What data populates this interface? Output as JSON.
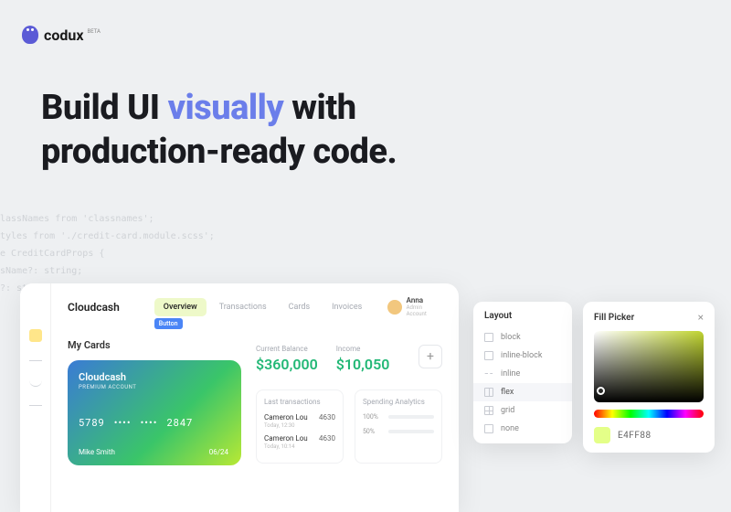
{
  "logo": {
    "text": "codux",
    "beta": "BETA"
  },
  "hero": {
    "pre": "Build UI ",
    "hl": "visually",
    "post": " with\nproduction-ready code."
  },
  "code_bg": "lassNames from 'classnames';\ntyles from './credit-card.module.scss';\ne CreditCardProps {\nsName?: string;\n?: string;",
  "dashboard": {
    "brand": "Cloudcash",
    "tabs": [
      {
        "label": "Overview",
        "active": true,
        "badge": "Button"
      },
      {
        "label": "Transactions",
        "active": false
      },
      {
        "label": "Cards",
        "active": false
      },
      {
        "label": "Invoices",
        "active": false
      }
    ],
    "user": {
      "name": "Anna",
      "subtitle": "Admin Account"
    },
    "mycards_label": "My Cards",
    "card": {
      "title": "Cloudcash",
      "subtitle": "PREMIUM ACCOUNT",
      "number_groups": [
        "5789",
        "••••",
        "••••",
        "2847"
      ],
      "holder": "Mike Smith",
      "expiry": "06/24"
    },
    "balance": {
      "label": "Current Balance",
      "value": "$360,000"
    },
    "income": {
      "label": "Income",
      "value": "$10,050"
    },
    "transactions_panel": {
      "title": "Last transactions",
      "rows": [
        {
          "name": "Cameron Lou",
          "date": "Today, 12:30",
          "amount": "4630"
        },
        {
          "name": "Cameron Lou",
          "date": "Today, 10:14",
          "amount": "4630"
        }
      ]
    },
    "analytics_panel": {
      "title": "Spending Analytics",
      "bars": [
        {
          "label": "100%"
        },
        {
          "label": "50%"
        }
      ]
    }
  },
  "layout_panel": {
    "title": "Layout",
    "items": [
      {
        "label": "block",
        "icon": "box"
      },
      {
        "label": "inline-block",
        "icon": "box"
      },
      {
        "label": "inline",
        "icon": "dash"
      },
      {
        "label": "flex",
        "icon": "flex",
        "selected": true
      },
      {
        "label": "grid",
        "icon": "grid"
      },
      {
        "label": "none",
        "icon": "box"
      }
    ]
  },
  "fill_picker": {
    "title": "Fill Picker",
    "close": "×",
    "hex": "E4FF88"
  }
}
